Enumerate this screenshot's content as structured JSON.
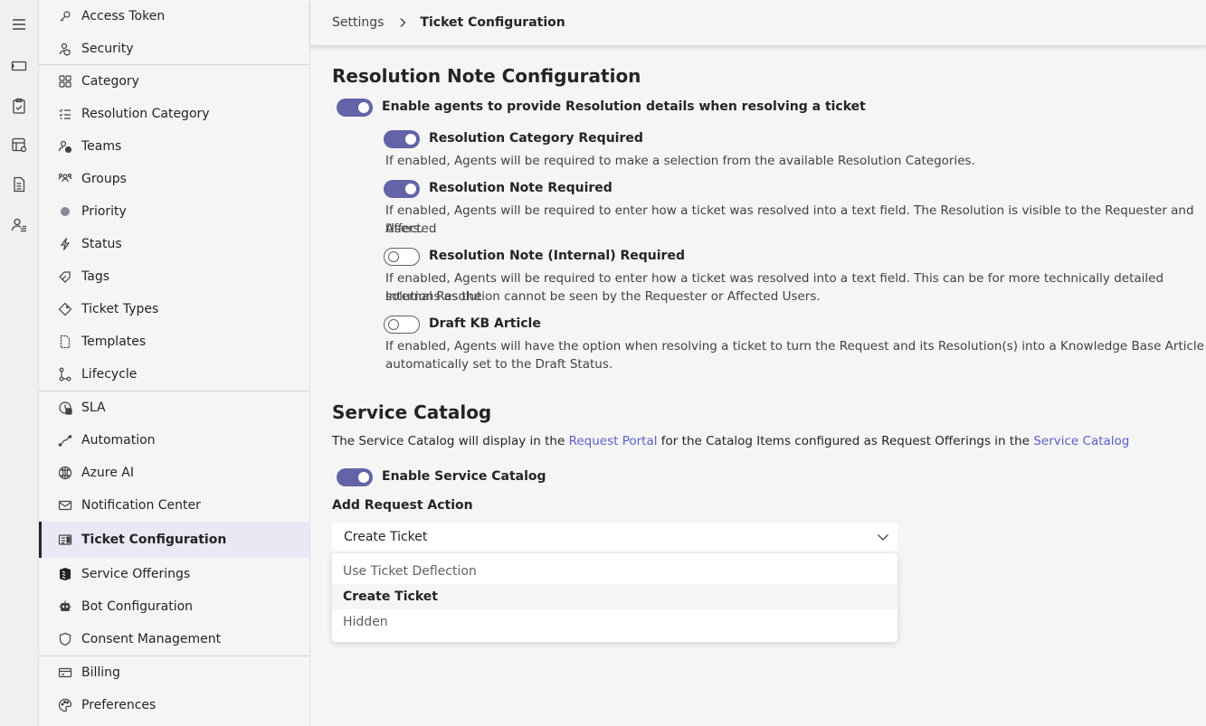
{
  "rail": {
    "items": [
      {
        "icon": "menu-icon"
      },
      {
        "icon": "ticket-icon"
      },
      {
        "icon": "clipboard-icon"
      },
      {
        "icon": "catalog-icon"
      },
      {
        "icon": "document-icon"
      },
      {
        "icon": "people-list-icon"
      }
    ]
  },
  "sidebar": {
    "items": [
      {
        "label": "Access Token",
        "icon": "key-icon"
      },
      {
        "label": "Security",
        "icon": "security-icon"
      },
      {
        "label": "Category",
        "icon": "grid-icon"
      },
      {
        "label": "Resolution Category",
        "icon": "checklist-icon"
      },
      {
        "label": "Teams",
        "icon": "teams-icon"
      },
      {
        "label": "Groups",
        "icon": "groups-icon"
      },
      {
        "label": "Priority",
        "icon": "dot-icon"
      },
      {
        "label": "Status",
        "icon": "flash-icon"
      },
      {
        "label": "Tags",
        "icon": "tag-icon"
      },
      {
        "label": "Ticket Types",
        "icon": "ticket-diamond-icon"
      },
      {
        "label": "Templates",
        "icon": "template-icon"
      },
      {
        "label": "Lifecycle",
        "icon": "lifecycle-icon"
      },
      {
        "label": "SLA",
        "icon": "sla-icon"
      },
      {
        "label": "Automation",
        "icon": "automation-icon"
      },
      {
        "label": "Azure AI",
        "icon": "brain-icon"
      },
      {
        "label": "Notification Center",
        "icon": "mail-icon"
      },
      {
        "label": "Ticket Configuration",
        "icon": "ticket-config-icon"
      },
      {
        "label": "Service Offerings",
        "icon": "service-icon"
      },
      {
        "label": "Bot Configuration",
        "icon": "bot-icon"
      },
      {
        "label": "Consent Management",
        "icon": "shield-icon"
      },
      {
        "label": "Billing",
        "icon": "billing-icon"
      },
      {
        "label": "Preferences",
        "icon": "palette-icon"
      }
    ],
    "active": "Ticket Configuration"
  },
  "header": {
    "breadcrumb_root": "Settings",
    "breadcrumb_current": "Ticket Configuration"
  },
  "resolution": {
    "title": "Resolution Note Configuration",
    "enable_label": "Enable agents to provide Resolution details when resolving a ticket",
    "enable_on": true,
    "options": [
      {
        "label": "Resolution Category Required",
        "on": true,
        "desc": "If enabled, Agents will be required to make a selection from the available Resolution Categories."
      },
      {
        "label": "Resolution Note Required",
        "on": true,
        "desc_line1": "If enabled, Agents will be required to enter how a ticket was resolved into a text field. The Resolution is visible to the Requester and Affected",
        "desc_line2": "Users."
      },
      {
        "label": "Resolution Note (Internal) Required",
        "on": false,
        "desc_line1": "If enabled, Agents will be required to enter how a ticket was resolved into a text field. This can be for more technically detailed solutions as the",
        "desc_line2": "Internal Resolution cannot be seen by the Requester or Affected Users."
      },
      {
        "label": "Draft KB Article",
        "on": false,
        "desc_line1": "If enabled, Agents will have the option when resolving a ticket to turn the Request and its Resolution(s) into a Knowledge Base Article",
        "desc_line2": "automatically set to the Draft Status."
      }
    ]
  },
  "service_catalog": {
    "title": "Service Catalog",
    "desc_part1": "The Service Catalog will display in the ",
    "link1": "Request Portal",
    "desc_part2": " for the Catalog Items configured as Request Offerings in the ",
    "link2": "Service Catalog",
    "enable_label": "Enable Service Catalog",
    "enable_on": true,
    "action_label": "Add Request Action",
    "selected": "Create Ticket",
    "options": [
      "Use Ticket Deflection",
      "Create Ticket",
      "Hidden"
    ]
  }
}
